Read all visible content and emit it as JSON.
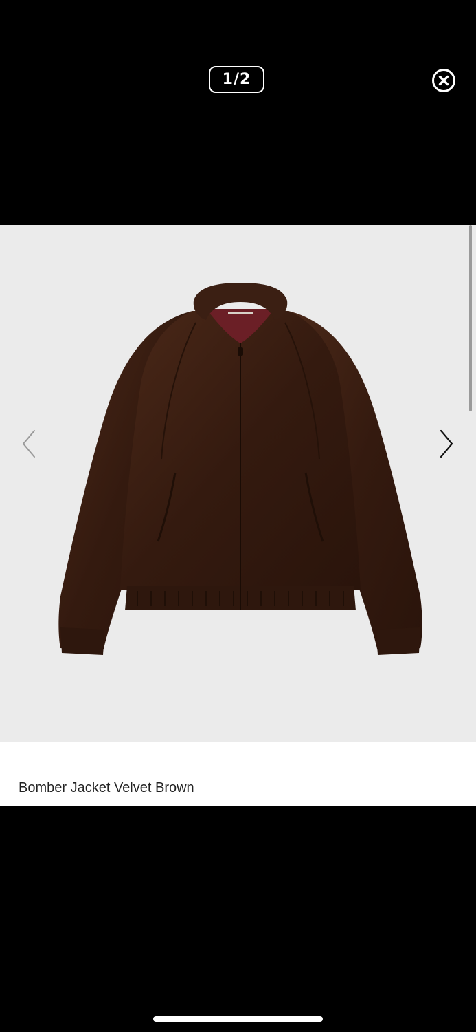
{
  "viewer": {
    "counter": "1/2",
    "product_title": "Bomber Jacket Velvet Brown",
    "icons": {
      "close": "close-circle-icon",
      "previous": "chevron-left-icon",
      "next": "chevron-right-icon"
    },
    "colors": {
      "background": "#000000",
      "image_background": "#ebebeb",
      "jacket": "#3a1e12",
      "lining": "#6b1f26",
      "caption_text": "#222222"
    }
  }
}
